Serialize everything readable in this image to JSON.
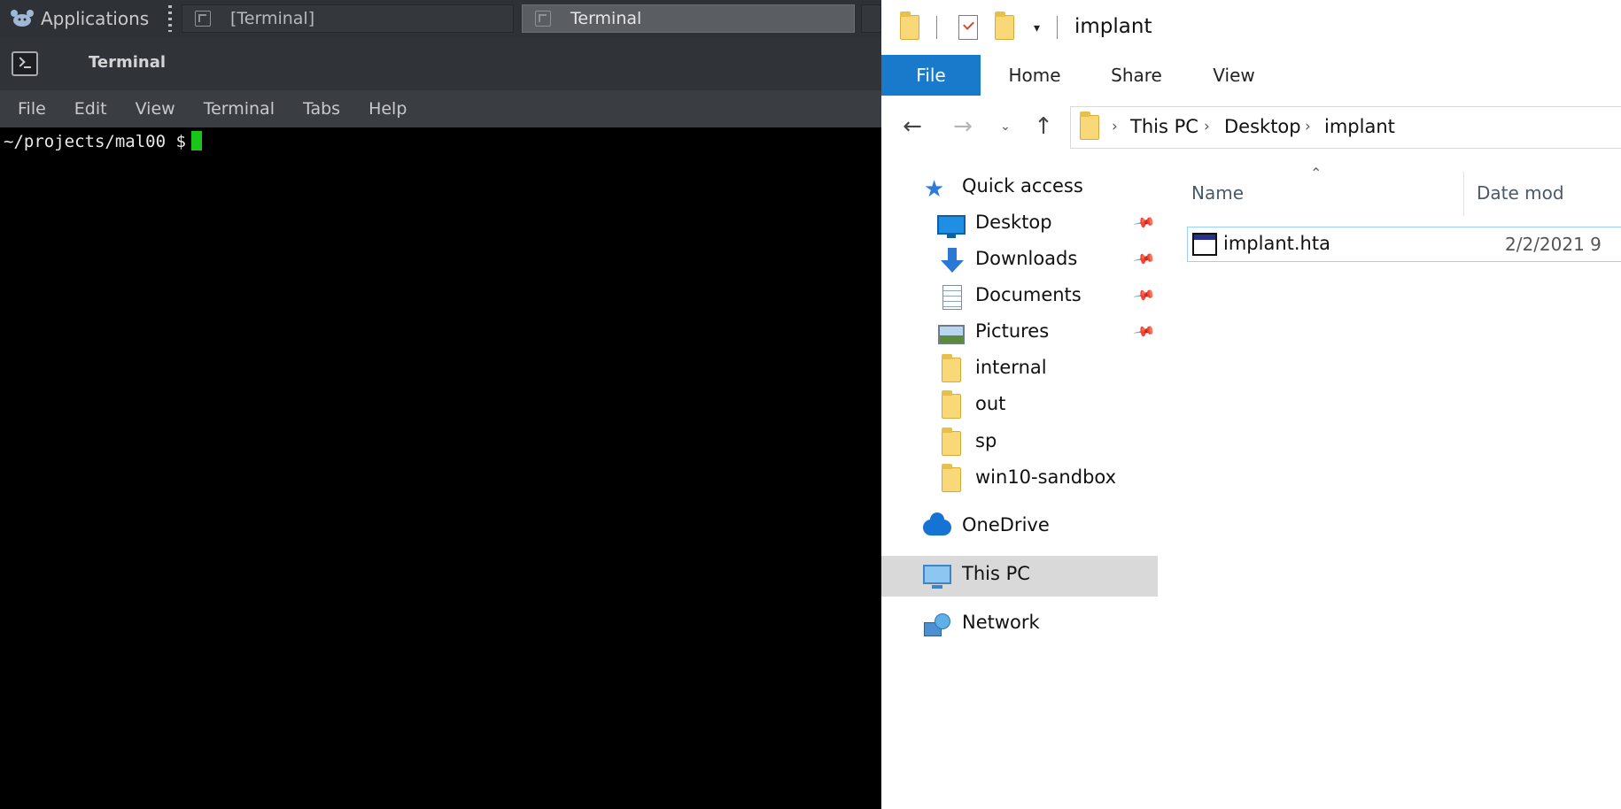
{
  "linux": {
    "taskbar": {
      "applications_label": "Applications",
      "tasks": [
        {
          "label": "[Terminal]"
        },
        {
          "label": "Terminal"
        }
      ]
    },
    "window": {
      "title": "Terminal",
      "menu": [
        "File",
        "Edit",
        "View",
        "Terminal",
        "Tabs",
        "Help"
      ]
    },
    "terminal": {
      "prompt": "~/projects/mal00 $"
    }
  },
  "explorer": {
    "title": "implant",
    "ribbon_tabs": [
      "File",
      "Home",
      "Share",
      "View"
    ],
    "breadcrumb": [
      "This PC",
      "Desktop",
      "implant"
    ],
    "nav": {
      "quick_access": "Quick access",
      "pinned": [
        "Desktop",
        "Downloads",
        "Documents",
        "Pictures"
      ],
      "folders": [
        "internal",
        "out",
        "sp",
        "win10-sandbox"
      ],
      "onedrive": "OneDrive",
      "this_pc": "This PC",
      "network": "Network"
    },
    "columns": {
      "name": "Name",
      "date": "Date mod"
    },
    "files": [
      {
        "name": "implant.hta",
        "date": "2/2/2021 9"
      }
    ],
    "colors": {
      "file_tab": "#1979ca",
      "selected_nav": "#d9d9d9",
      "cursor": "#18c518"
    }
  }
}
